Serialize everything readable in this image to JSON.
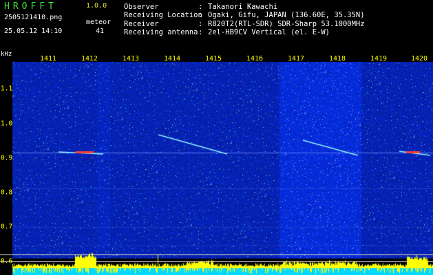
{
  "header": {
    "app_title": "HROFFT",
    "version": "1.0.0",
    "filename": "2505121410.png",
    "datetime": "25.05.12 14:10",
    "meteor_label": "meteor",
    "meteor_count": "41",
    "info": [
      {
        "label": "Observer",
        "value": "Takanori Kawachi"
      },
      {
        "label": "Receiving Location",
        "value": "Ogaki, Gifu, JAPAN (136.60E, 35.35N)"
      },
      {
        "label": "Receiver",
        "value": "R820T2(RTL-SDR) SDR-Sharp 53.1000MHz"
      },
      {
        "label": "Receiving antenna",
        "value": "2el-HB9CV Vertical (el. E-W)"
      }
    ]
  },
  "axes": {
    "unit": "kHz",
    "frequency_ticks": [
      "1411",
      "1412",
      "1413",
      "1414",
      "1415",
      "1416",
      "1417",
      "1418",
      "1419",
      "1420"
    ],
    "y_ticks": [
      "1.1",
      "1.0",
      "0.9",
      "0.8",
      "0.7",
      "0.6"
    ]
  },
  "colors": {
    "background": "#000000",
    "noise": "#1a2a9a",
    "tick_label": "#ffff00",
    "title": "#3fe03f",
    "spectrum": "#ffff00",
    "baseline": "#00d8ff"
  }
}
